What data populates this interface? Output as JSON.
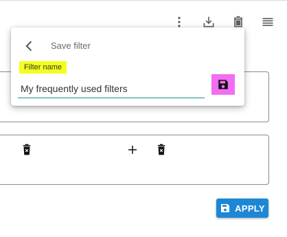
{
  "toolbar": {
    "icons": [
      "more-vert-icon",
      "download-icon",
      "clipboard-icon",
      "menu-icon"
    ]
  },
  "popover": {
    "title": "Save filter",
    "field_label": "Filter name",
    "field_value": "My frequently used filters"
  },
  "actions": {
    "apply_label": "APPLY"
  },
  "colors": {
    "apply_bg": "#1d87d6",
    "label_highlight": "#f4ff1d",
    "save_highlight": "#f26df2",
    "input_underline": "#1a8a8a"
  }
}
